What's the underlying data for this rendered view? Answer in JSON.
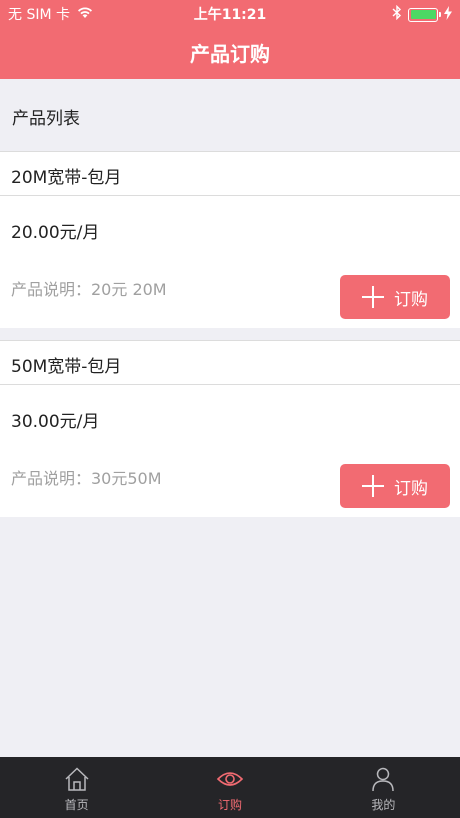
{
  "status_bar": {
    "carrier": "无 SIM 卡",
    "time": "上午11:21"
  },
  "header": {
    "title": "产品订购"
  },
  "section": {
    "title": "产品列表"
  },
  "products": [
    {
      "name": "20M宽带-包月",
      "price": "20.00元/月",
      "description": "产品说明：20元 20M",
      "button_label": "订购"
    },
    {
      "name": "50M宽带-包月",
      "price": "30.00元/月",
      "description": "产品说明：30元50M",
      "button_label": "订购"
    }
  ],
  "tabs": [
    {
      "label": "首页",
      "icon": "home-icon",
      "active": false
    },
    {
      "label": "订购",
      "icon": "eye-icon",
      "active": true
    },
    {
      "label": "我的",
      "icon": "user-icon",
      "active": false
    }
  ],
  "colors": {
    "accent": "#f26b72",
    "tab_bar": "#252528",
    "background": "#efeff4",
    "battery": "#4cd964"
  }
}
